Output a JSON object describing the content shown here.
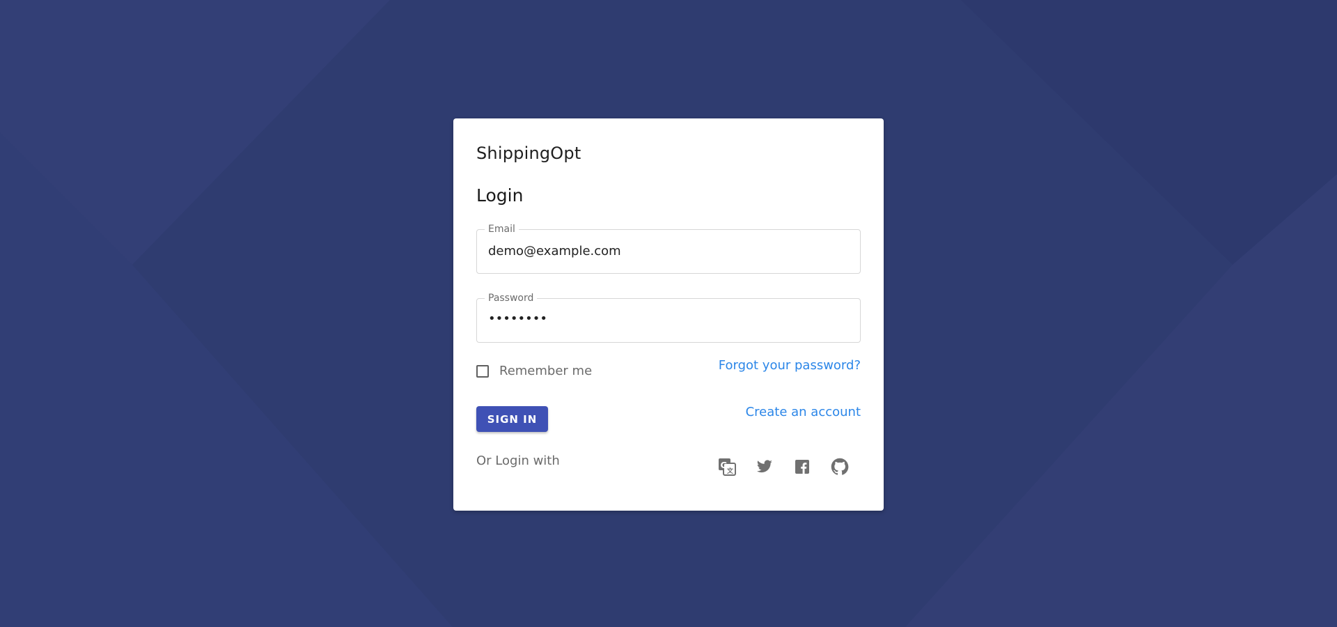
{
  "brand": "ShippingOpt",
  "heading": "Login",
  "email": {
    "label": "Email",
    "value": "demo@example.com"
  },
  "password": {
    "label": "Password",
    "value": "••••••••"
  },
  "remember": {
    "label": "Remember me",
    "checked": false
  },
  "links": {
    "forgot": "Forgot your password?",
    "create": "Create an account"
  },
  "signin_label": "SIGN IN",
  "or_login_with": "Or Login with",
  "social_icons": [
    "google-translate-icon",
    "twitter-icon",
    "facebook-icon",
    "github-icon"
  ],
  "colors": {
    "background": "#313d72",
    "primary_button": "#3f51b5",
    "link": "#2b86e8",
    "social_icon": "#707070"
  }
}
